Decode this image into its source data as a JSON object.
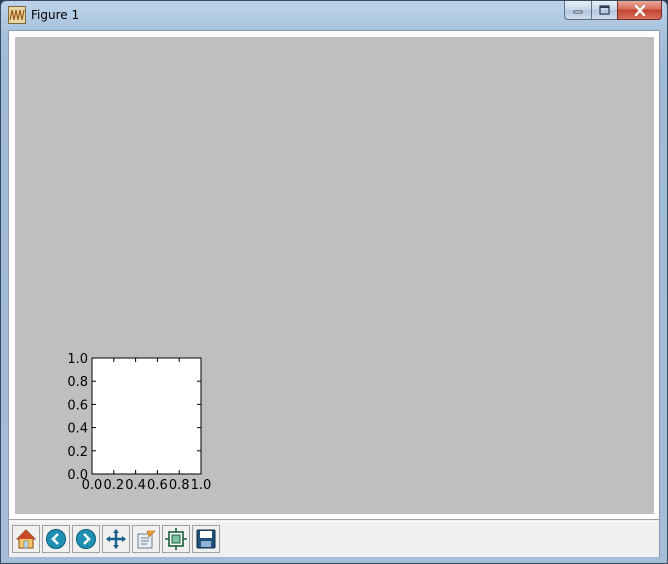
{
  "window": {
    "title": "Figure 1",
    "icon": "matplotlib-figure-icon"
  },
  "caption_buttons": [
    "minimize-icon",
    "maximize-icon",
    "close-icon"
  ],
  "figure": {
    "background_color": "#bfbfbf",
    "axes_facecolor": "#ffffff"
  },
  "chart_data": {
    "type": "line",
    "title": "",
    "xlabel": "",
    "ylabel": "",
    "xlim": [
      0.0,
      1.0
    ],
    "ylim": [
      0.0,
      1.0
    ],
    "x_tick_labels": [
      "0.0",
      "0.2",
      "0.4",
      "0.6",
      "0.8",
      "1.0"
    ],
    "y_tick_labels": [
      "0.0",
      "0.2",
      "0.4",
      "0.6",
      "0.8",
      "1.0"
    ],
    "series": [],
    "grid": false
  },
  "toolbar": {
    "buttons": [
      {
        "icon": "home-icon"
      },
      {
        "icon": "back-arrow-icon"
      },
      {
        "icon": "forward-arrow-icon"
      },
      {
        "icon": "pan-move-icon"
      },
      {
        "icon": "zoom-rect-icon"
      },
      {
        "icon": "subplots-config-icon"
      },
      {
        "icon": "save-disk-icon"
      }
    ]
  }
}
